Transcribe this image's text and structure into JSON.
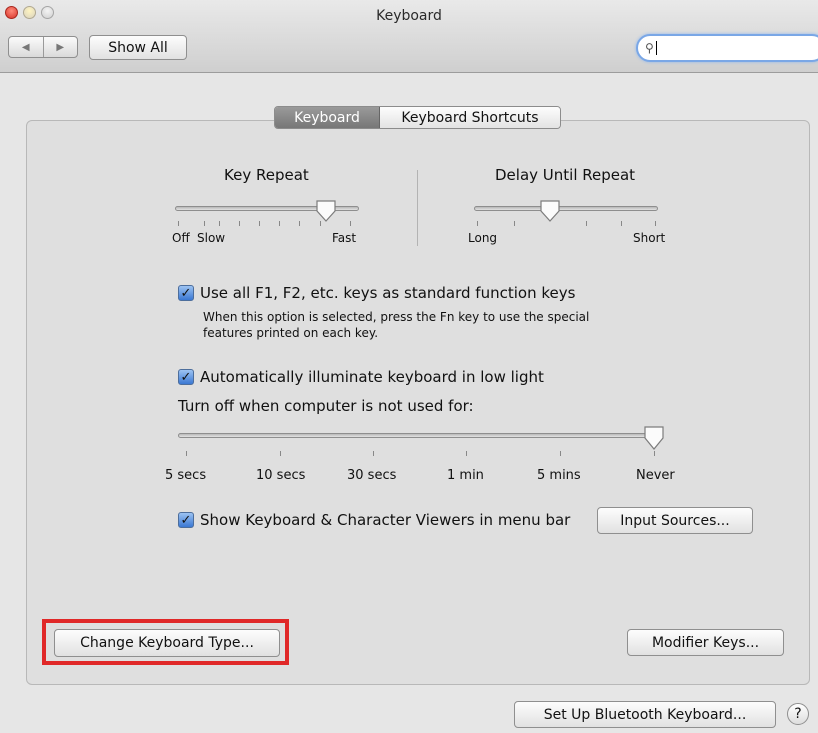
{
  "window": {
    "title": "Keyboard"
  },
  "toolbar": {
    "back_icon": "◀",
    "forward_icon": "▶",
    "show_all_label": "Show All"
  },
  "search": {
    "value": "",
    "placeholder": ""
  },
  "tabs": [
    {
      "label": "Keyboard",
      "selected": true
    },
    {
      "label": "Keyboard Shortcuts",
      "selected": false
    }
  ],
  "key_repeat": {
    "label": "Key Repeat",
    "labels": [
      "Off",
      "Slow",
      "Fast"
    ],
    "value_fraction": 0.85
  },
  "delay_until_repeat": {
    "label": "Delay Until Repeat",
    "labels": [
      "Long",
      "Short"
    ],
    "value_fraction": 0.4
  },
  "fn_keys": {
    "checked": true,
    "label": "Use all F1, F2, etc. keys as standard function keys",
    "help_line1": "When this option is selected, press the Fn key to use the special",
    "help_line2": "features printed on each key."
  },
  "illuminate": {
    "checked": true,
    "label": "Automatically illuminate keyboard in low light",
    "turn_off_label": "Turn off when computer is not used for:",
    "stops": [
      "5 secs",
      "10 secs",
      "30 secs",
      "1 min",
      "5 mins",
      "Never"
    ],
    "selected": "Never"
  },
  "viewers": {
    "checked": true,
    "label": "Show Keyboard & Character Viewers in menu bar",
    "input_sources_label": "Input Sources..."
  },
  "buttons": {
    "change_keyboard_type": "Change Keyboard Type...",
    "modifier_keys": "Modifier Keys...",
    "bluetooth": "Set Up Bluetooth Keyboard...",
    "help": "?"
  },
  "colors": {
    "accent": "#3a78d3",
    "highlight_box": "#e02828"
  }
}
